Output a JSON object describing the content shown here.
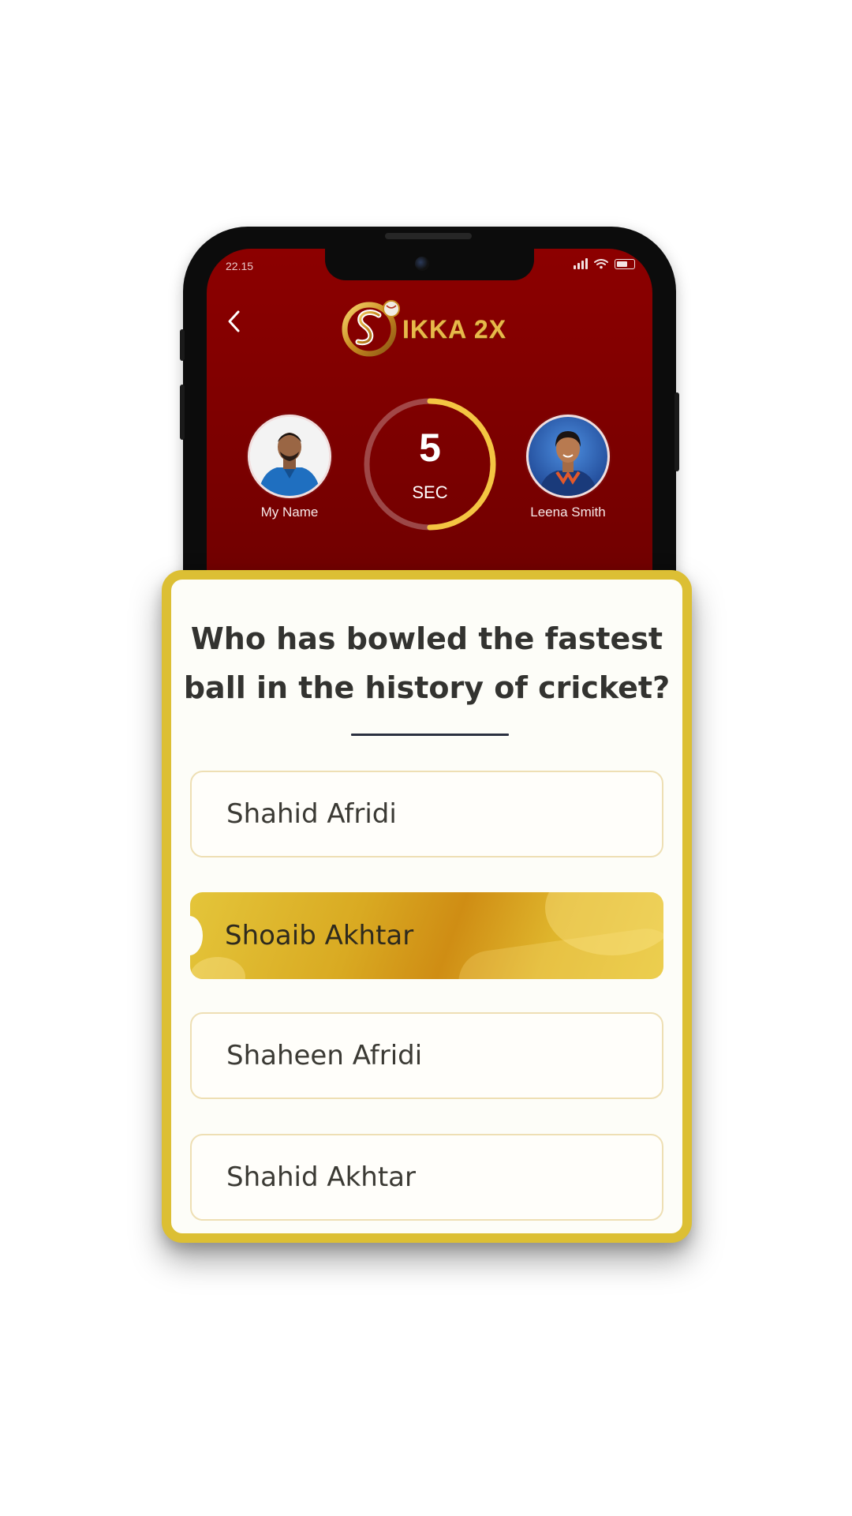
{
  "status_bar": {
    "time": "22.15"
  },
  "header": {
    "logo_text": "IKKA 2X"
  },
  "players": {
    "left": {
      "name": "My Name"
    },
    "right": {
      "name": "Leena Smith"
    }
  },
  "timer": {
    "value": "5",
    "unit": "SEC",
    "progress_fraction": 0.5
  },
  "quiz": {
    "question": "Who has bowled the fastest ball in the history of cricket?",
    "options": [
      {
        "label": "Shahid Afridi",
        "selected": false
      },
      {
        "label": "Shoaib Akhtar",
        "selected": true
      },
      {
        "label": "Shaheen Afridi",
        "selected": false
      },
      {
        "label": "Shahid Akhtar",
        "selected": false
      }
    ]
  },
  "colors": {
    "header_bg": "#8c0000",
    "accent_gold": "#dcbf34",
    "timer_ring": "#f4c542",
    "card_bg": "#fdfdf8"
  },
  "icons": [
    "back-chevron-icon",
    "signal-icon",
    "wifi-icon",
    "battery-icon",
    "front-camera-icon"
  ]
}
